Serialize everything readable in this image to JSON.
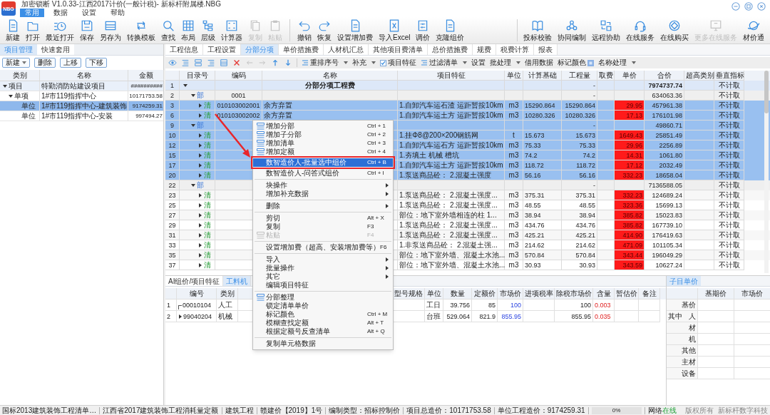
{
  "window": {
    "logo": "NBG",
    "title": "加密锁断 V1.0.33-江西2017计价(一般计税)- 新标杆附属楼.NBG"
  },
  "menu_tabs": [
    {
      "label": "常用",
      "selected": true
    },
    {
      "label": "数据",
      "selected": false
    },
    {
      "label": "设置",
      "selected": false
    },
    {
      "label": "帮助",
      "selected": false
    }
  ],
  "toolbar": {
    "groups": [
      [
        {
          "label": "新建",
          "disabled": false
        },
        {
          "label": "打开",
          "disabled": false
        },
        {
          "label": "最近打开",
          "disabled": false
        },
        {
          "label": "保存",
          "disabled": false
        },
        {
          "label": "另存为",
          "disabled": false
        },
        {
          "label": "转换模板",
          "disabled": false
        },
        {
          "label": "查找",
          "disabled": false
        },
        {
          "label": "布局",
          "disabled": false
        },
        {
          "label": "层级",
          "disabled": false
        },
        {
          "label": "计算器",
          "disabled": false
        },
        {
          "label": "复制",
          "disabled": true
        },
        {
          "label": "粘贴",
          "disabled": true
        }
      ],
      [
        {
          "label": "撤销",
          "disabled": false
        },
        {
          "label": "恢复",
          "disabled": false
        },
        {
          "label": "设置增加费",
          "disabled": false
        },
        {
          "label": "导入Excel",
          "disabled": false
        },
        {
          "label": "调价",
          "disabled": false
        },
        {
          "label": "克隆组价",
          "disabled": false
        }
      ]
    ],
    "right": [
      {
        "label": "投标校验",
        "disabled": false
      },
      {
        "label": "协同编制",
        "disabled": false
      },
      {
        "label": "远程协助",
        "disabled": false
      },
      {
        "label": "在线服务",
        "disabled": false
      },
      {
        "label": "在线购买",
        "disabled": false
      },
      {
        "label": "更多在线服务",
        "disabled": true
      },
      {
        "label": "材价通",
        "disabled": false
      }
    ]
  },
  "project_panel": {
    "tabs": [
      {
        "label": "项目管理",
        "selected": true
      },
      {
        "label": "快速套用",
        "selected": false
      }
    ],
    "buttons": [
      {
        "label": "新建",
        "dropdown": true
      },
      {
        "label": "删除",
        "dropdown": false
      },
      {
        "label": "上移",
        "dropdown": false
      },
      {
        "label": "下移",
        "dropdown": false
      }
    ],
    "columns": [
      "类别",
      "名称",
      "金额"
    ],
    "tree": [
      {
        "category": "项目",
        "name": "特勤消防站建设项目",
        "amount": "##########",
        "selected": false,
        "expanded": true,
        "children": [
          {
            "category": "单项",
            "name": "1#市119指挥中心",
            "amount": "10171753.58",
            "selected": false,
            "expanded": true,
            "children": [
              {
                "category": "单位",
                "name": "1#市119指挥中心-建筑装饰",
                "amount": "9174259.31",
                "selected": true
              },
              {
                "category": "单位",
                "name": "1#市119指挥中心-安装",
                "amount": "997494.27",
                "selected": false
              }
            ]
          }
        ]
      }
    ]
  },
  "main_tabs": [
    {
      "label": "工程信息",
      "selected": false
    },
    {
      "label": "工程设置",
      "selected": false
    },
    {
      "label": "分部分项",
      "selected": true
    },
    {
      "label": "单价措施费",
      "selected": false
    },
    {
      "label": "人材机汇总",
      "selected": false
    },
    {
      "label": "其他项目费清单",
      "selected": false
    },
    {
      "label": "总价措施费",
      "selected": false
    },
    {
      "label": "规费",
      "selected": false
    },
    {
      "label": "税费计算",
      "selected": false
    },
    {
      "label": "报表",
      "selected": false
    }
  ],
  "grid_toolbar": [
    {
      "kind": "dropdown",
      "label": "重排序号"
    },
    {
      "kind": "dropdown",
      "label": "补充"
    },
    {
      "kind": "checkbox",
      "label": "项目特征",
      "checked": true
    },
    {
      "kind": "dropdown",
      "label": "过滤清单"
    },
    {
      "kind": "button",
      "label": "设置"
    },
    {
      "kind": "dropdown",
      "label": "批处理"
    },
    {
      "kind": "button",
      "label": "借用数据"
    },
    {
      "kind": "swatch",
      "label": "标记颜色"
    },
    {
      "kind": "dropdown",
      "label": "名称处理"
    }
  ],
  "grid": {
    "columns": [
      "目录号",
      "编码",
      "名称",
      "项目特征",
      "单位",
      "计算基础",
      "工程量",
      "取费",
      "单价",
      "合价",
      "超高类别",
      "垂直指标"
    ],
    "rows": [
      {
        "no": "1",
        "kind": "total",
        "expanded": true,
        "name": "分部分项工程费",
        "qty": "-",
        "total": "7974737.74",
        "vertical": "不计取",
        "selected": false
      },
      {
        "no": "2",
        "kind": "section",
        "tag": "部",
        "expanded": true,
        "code": "0001",
        "qty": "-",
        "total": "634063.36",
        "vertical": "不计取",
        "selected": false
      },
      {
        "no": "3",
        "kind": "item",
        "tag": "清",
        "expanded": false,
        "code": "010103002001",
        "name": "余方弃置",
        "feature": "1.自卸汽车运石渣 运距暂按10km",
        "unit": "m3",
        "base": "15290.864",
        "qty": "15290.864",
        "price": "29.95",
        "flagged": true,
        "total": "457961.38",
        "vertical": "不计取",
        "selected": true
      },
      {
        "no": "6",
        "kind": "item",
        "tag": "清",
        "expanded": false,
        "code": "010103002002",
        "name": "余方弃置",
        "feature": "1.自卸汽车运土方 运距暂按10km",
        "unit": "m3",
        "base": "10280.326",
        "qty": "10280.326",
        "price": "17.13",
        "flagged": true,
        "total": "176101.98",
        "vertical": "不计取",
        "selected": true
      },
      {
        "no": "9",
        "kind": "section",
        "tag": "部",
        "expanded": true,
        "qty": "-",
        "total": "49860.71",
        "vertical": "不计取",
        "selected": true
      },
      {
        "no": "10",
        "kind": "item",
        "tag": "清",
        "expanded": false,
        "feature": "1.挂Φ8@200×200钢筋网",
        "unit": "t",
        "base": "15.673",
        "qty": "15.673",
        "price": "1649.43",
        "flagged": true,
        "total": "25851.49",
        "vertical": "不计取",
        "selected": true
      },
      {
        "no": "12",
        "kind": "item",
        "tag": "清",
        "expanded": false,
        "feature": "1.自卸汽车运石方 运距暂按10km",
        "unit": "m3",
        "base": "75.33",
        "qty": "75.33",
        "price": "29.96",
        "flagged": true,
        "total": "2256.89",
        "vertical": "不计取",
        "selected": true
      },
      {
        "no": "15",
        "kind": "item",
        "tag": "清",
        "expanded": false,
        "feature": "1.夯填土 机械 槽坑",
        "unit": "m3",
        "base": "74.2",
        "qty": "74.2",
        "price": "14.31",
        "flagged": true,
        "total": "1061.80",
        "vertical": "不计取",
        "selected": true
      },
      {
        "no": "17",
        "kind": "item",
        "tag": "清",
        "expanded": false,
        "feature": "1.自卸汽车运土方 运距暂按10km",
        "unit": "m3",
        "base": "118.72",
        "qty": "118.72",
        "price": "17.12",
        "flagged": true,
        "total": "2032.49",
        "vertical": "不计取",
        "selected": true
      },
      {
        "no": "20",
        "kind": "item",
        "tag": "清",
        "expanded": false,
        "feature": "1.泵送商品砼： 2.混凝土强度",
        "unit": "m3",
        "base": "56.16",
        "qty": "56.16",
        "price": "332.23",
        "flagged": true,
        "total": "18658.04",
        "vertical": "不计取",
        "selected": true
      },
      {
        "no": "22",
        "kind": "section",
        "tag": "部",
        "expanded": true,
        "qty": "-",
        "total": "7136588.05",
        "vertical": "不计取",
        "selected": false
      },
      {
        "no": "23",
        "kind": "item",
        "tag": "清",
        "expanded": false,
        "feature": "1.泵送商品砼： 2.混凝土强度...",
        "unit": "m3",
        "base": "375.31",
        "qty": "375.31",
        "price": "332.23",
        "flagged": true,
        "total": "124689.24",
        "vertical": "不计取",
        "selected": false
      },
      {
        "no": "25",
        "kind": "item",
        "tag": "清",
        "expanded": false,
        "feature": "1.泵送商品砼： 2.混凝土强度...",
        "unit": "m3",
        "base": "48.55",
        "qty": "48.55",
        "price": "323.36",
        "flagged": true,
        "total": "15699.13",
        "vertical": "不计取",
        "selected": false
      },
      {
        "no": "27",
        "kind": "item",
        "tag": "清",
        "expanded": false,
        "feature": "部位：地下室外墙相连的柱 1...",
        "unit": "m3",
        "base": "38.94",
        "qty": "38.94",
        "price": "385.82",
        "flagged": true,
        "total": "15023.83",
        "vertical": "不计取",
        "selected": false
      },
      {
        "no": "29",
        "kind": "item",
        "tag": "清",
        "expanded": false,
        "feature": "1.泵送商品砼： 2.混凝土强度...",
        "unit": "m3",
        "base": "434.76",
        "qty": "434.76",
        "price": "385.82",
        "flagged": true,
        "total": "167739.10",
        "vertical": "不计取",
        "selected": false
      },
      {
        "no": "31",
        "kind": "item",
        "tag": "清",
        "expanded": false,
        "feature": "1.泵送商品砼： 2.混凝土强度...",
        "unit": "m3",
        "base": "425.21",
        "qty": "425.21",
        "price": "414.90",
        "flagged": true,
        "total": "176419.63",
        "vertical": "不计取",
        "selected": false
      },
      {
        "no": "33",
        "kind": "item",
        "tag": "清",
        "expanded": false,
        "feature": "1.非泵送商品砼： 2.混凝土强...",
        "unit": "m3",
        "base": "214.62",
        "qty": "214.62",
        "price": "471.09",
        "flagged": true,
        "total": "101105.34",
        "vertical": "不计取",
        "selected": false
      },
      {
        "no": "35",
        "kind": "item",
        "tag": "清",
        "expanded": false,
        "feature": "部位：地下室外墙、混凝土水池...",
        "unit": "m3",
        "base": "570.84",
        "qty": "570.84",
        "price": "343.44",
        "flagged": true,
        "total": "196049.29",
        "vertical": "不计取",
        "selected": false
      },
      {
        "no": "37",
        "kind": "item",
        "tag": "清",
        "expanded": false,
        "feature": "部位：地下室外墙、混凝土水池...",
        "unit": "m3",
        "base": "30.93",
        "qty": "30.93",
        "price": "343.59",
        "flagged": true,
        "total": "10627.24",
        "vertical": "不计取",
        "selected": false
      }
    ]
  },
  "bottom_panel": {
    "tabs": [
      {
        "label": "AI组价/项目特征",
        "selected": false
      },
      {
        "label": "工料机",
        "selected": true
      }
    ],
    "columns": [
      "编号",
      "类别",
      "型号规格",
      "单位",
      "数量",
      "定额价",
      "市场价",
      "进项税率",
      "除税市场价",
      "含量",
      "暂估价",
      "备注"
    ],
    "rows": [
      {
        "no": "1",
        "has_children": false,
        "code": "00010104",
        "type": "人工",
        "unit": "工日",
        "qty": "39.756",
        "quota_price": "85",
        "market_price": "100",
        "ex_tax_price": "100",
        "content": "0.003"
      },
      {
        "no": "2",
        "has_children": true,
        "code": "99040204",
        "type": "机械",
        "unit": "台班",
        "qty": "529.064",
        "quota_price": "821.9",
        "market_price": "855.95",
        "ex_tax_price": "855.95",
        "content": "0.035"
      }
    ]
  },
  "unit_price_panel": {
    "tab": "子目单价",
    "columns": [
      "基期价",
      "市场价"
    ],
    "rows": [
      {
        "label": "基价"
      },
      {
        "group": "其中",
        "label": "人"
      },
      {
        "label": "材"
      },
      {
        "label": "机"
      },
      {
        "label": "其他"
      },
      {
        "label": "主材"
      },
      {
        "label": "设备"
      }
    ]
  },
  "context_menu": [
    {
      "kind": "icon_item",
      "label": "增加分部",
      "shortcut": "Ctrl + 1",
      "selected": false,
      "disabled": false
    },
    {
      "kind": "icon_item",
      "label": "增加子分部",
      "shortcut": "Ctrl + 2",
      "selected": false,
      "disabled": false
    },
    {
      "kind": "icon_item",
      "label": "增加清单",
      "shortcut": "Ctrl + 3",
      "selected": false,
      "disabled": false
    },
    {
      "kind": "icon_item",
      "label": "增加定额",
      "shortcut": "Ctrl + 4",
      "selected": false,
      "disabled": false
    },
    {
      "kind": "item",
      "label": "数智造价人-批量选中组价",
      "shortcut": "Ctrl + B",
      "selected": true,
      "disabled": false
    },
    {
      "kind": "item",
      "label": "数智造价人-问答式组价",
      "shortcut": "Ctrl + I",
      "selected": false,
      "disabled": false
    },
    {
      "kind": "separator"
    },
    {
      "kind": "submenu",
      "label": "块操作",
      "selected": false,
      "disabled": false
    },
    {
      "kind": "submenu",
      "label": "增加补充数据",
      "selected": false,
      "disabled": false
    },
    {
      "kind": "separator"
    },
    {
      "kind": "submenu",
      "label": "删除",
      "selected": false,
      "disabled": false
    },
    {
      "kind": "separator"
    },
    {
      "kind": "item",
      "label": "剪切",
      "shortcut": "Alt + X",
      "selected": false,
      "disabled": false
    },
    {
      "kind": "item",
      "label": "复制",
      "shortcut": "F3",
      "selected": false,
      "disabled": false
    },
    {
      "kind": "icon_item",
      "label": "粘贴",
      "shortcut": "F4",
      "selected": false,
      "disabled": true
    },
    {
      "kind": "separator"
    },
    {
      "kind": "item",
      "label": "设置增加费（超高、安装增加费等）",
      "shortcut": "F6",
      "selected": false,
      "disabled": false
    },
    {
      "kind": "separator"
    },
    {
      "kind": "submenu",
      "label": "导入",
      "selected": false,
      "disabled": false
    },
    {
      "kind": "submenu",
      "label": "批量操作",
      "selected": false,
      "disabled": false
    },
    {
      "kind": "submenu",
      "label": "其它",
      "selected": false,
      "disabled": false
    },
    {
      "kind": "item",
      "label": "编辑项目特征",
      "selected": false,
      "disabled": false
    },
    {
      "kind": "separator"
    },
    {
      "kind": "icon_item",
      "label": "分部整理",
      "selected": false,
      "disabled": false
    },
    {
      "kind": "item",
      "label": "锁定清单单价",
      "selected": false,
      "disabled": false
    },
    {
      "kind": "item",
      "label": "标记颜色",
      "shortcut": "Ctrl + M",
      "selected": false,
      "disabled": false
    },
    {
      "kind": "item",
      "label": "模糊查找定额",
      "shortcut": "Alt + T",
      "selected": false,
      "disabled": false
    },
    {
      "kind": "item",
      "label": "根据定额号反查清单",
      "shortcut": "Alt + Q",
      "selected": false,
      "disabled": false
    },
    {
      "kind": "separator"
    },
    {
      "kind": "item",
      "label": "复制单元格数据",
      "selected": false,
      "disabled": false
    }
  ],
  "status_bar": {
    "items": [
      "国标2013建筑装饰工程清单…",
      "江西省2017建筑装饰工程消耗量定额",
      "建筑工程",
      "赣建价【2019】1号",
      "编制类型：招标控制价",
      "项目总造价：10171753.58",
      "单位工程造价：9174259.31"
    ],
    "progress": {
      "label": "0%",
      "level": 0
    },
    "network": {
      "label": "网络",
      "status": "在线",
      "online": true
    },
    "right": [
      "版权所有",
      "新标杆数字科技"
    ]
  }
}
